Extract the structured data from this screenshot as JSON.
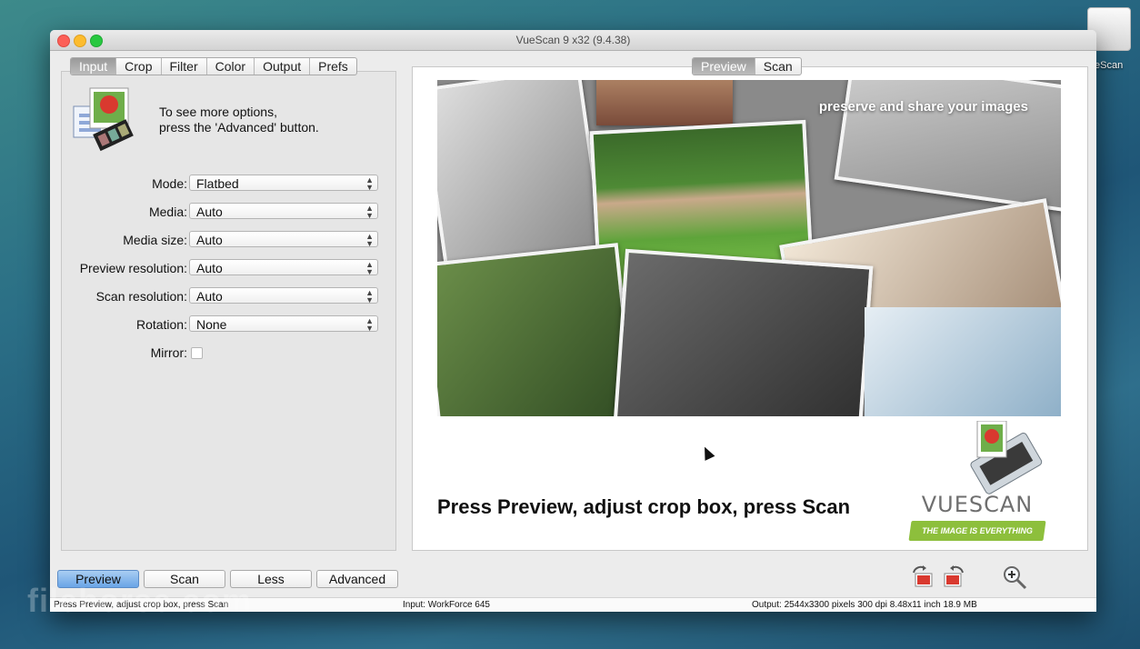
{
  "desktop": {
    "drive_label": "eScan"
  },
  "window": {
    "title": "VueScan 9 x32 (9.4.38)"
  },
  "left_tabs": [
    {
      "label": "Input",
      "active": true
    },
    {
      "label": "Crop",
      "active": false
    },
    {
      "label": "Filter",
      "active": false
    },
    {
      "label": "Color",
      "active": false
    },
    {
      "label": "Output",
      "active": false
    },
    {
      "label": "Prefs",
      "active": false
    }
  ],
  "info": {
    "line1": "To see more options,",
    "line2": "press the 'Advanced' button."
  },
  "form": {
    "mode": {
      "label": "Mode:",
      "value": "Flatbed"
    },
    "media": {
      "label": "Media:",
      "value": "Auto"
    },
    "media_size": {
      "label": "Media size:",
      "value": "Auto"
    },
    "preview_resolution": {
      "label": "Preview resolution:",
      "value": "Auto"
    },
    "scan_resolution": {
      "label": "Scan resolution:",
      "value": "Auto"
    },
    "rotation": {
      "label": "Rotation:",
      "value": "None"
    },
    "mirror": {
      "label": "Mirror:",
      "checked": false
    }
  },
  "right_tabs": [
    {
      "label": "Preview",
      "active": true
    },
    {
      "label": "Scan",
      "active": false
    }
  ],
  "preview": {
    "tagline": "preserve and share your images",
    "caption": "Press Preview, adjust crop box, press Scan",
    "logo_word": "VUESCAN",
    "logo_sub": "THE IMAGE IS EVERYTHING"
  },
  "buttons": {
    "preview": "Preview",
    "scan": "Scan",
    "less": "Less",
    "advanced": "Advanced"
  },
  "status": {
    "left": "Press Preview, adjust crop box, press Scan",
    "middle": "Input: WorkForce 645",
    "right": "Output: 2544x3300 pixels 300 dpi 8.48x11 inch 18.9 MB"
  },
  "watermark": "filehorse.com",
  "colors": {
    "accent_button": "#6aa5e6",
    "logo_green": "#8dbf3c"
  }
}
